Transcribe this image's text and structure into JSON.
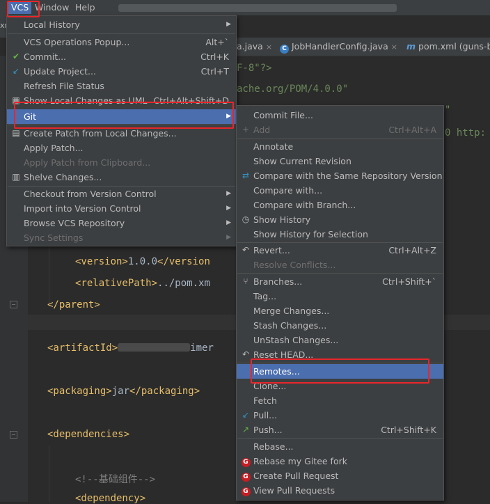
{
  "menubar": {
    "vcs": "VCS",
    "window": "Window",
    "help": "Help",
    "left_frag": "xn"
  },
  "tabs": [
    {
      "label": "a.java"
    },
    {
      "icon": "C",
      "label": "JobHandlerConfig.java"
    },
    {
      "icon": "m",
      "label": "pom.xml (guns-ba"
    }
  ],
  "editor": {
    "frag1": "F-8\"?>",
    "frag2": "ache.org/POM/4.0.0\"",
    "frag3": "\"",
    "frag4": "0 http:",
    "version_open": "<version>",
    "version_val": "1.0.0",
    "version_close": "</version",
    "relpath_open": "<relativePath>",
    "relpath_val": "../pom.xm",
    "parent_close": "</parent>",
    "artifact_open": "<artifactId>",
    "artifact_tail": "imer",
    "packaging_open": "<packaging>",
    "packaging_val": "jar",
    "packaging_close": "</packaging>",
    "deps_open": "<dependencies>",
    "comment": "<!--基础组件-->",
    "dep_open": "<dependency>"
  },
  "vcs_menu": {
    "items": [
      {
        "label": "Local History",
        "submenu": true
      },
      {
        "label": "VCS Operations Popup...",
        "shortcut": "Alt+`"
      },
      {
        "label": "Commit...",
        "shortcut": "Ctrl+K",
        "icon": "✔"
      },
      {
        "label": "Update Project...",
        "shortcut": "Ctrl+T",
        "icon": "↙"
      },
      {
        "label": "Refresh File Status"
      },
      {
        "label": "Show Local Changes as UML",
        "shortcut": "Ctrl+Alt+Shift+D",
        "icon": "▦"
      },
      {
        "label": "Git",
        "submenu": true,
        "selected": true
      },
      {
        "label": "Create Patch from Local Changes...",
        "icon": "▤"
      },
      {
        "label": "Apply Patch..."
      },
      {
        "label": "Apply Patch from Clipboard...",
        "disabled": true
      },
      {
        "label": "Shelve Changes...",
        "icon": "▥"
      },
      {
        "label": "Checkout from Version Control",
        "submenu": true
      },
      {
        "label": "Import into Version Control",
        "submenu": true
      },
      {
        "label": "Browse VCS Repository",
        "submenu": true
      },
      {
        "label": "Sync Settings",
        "submenu": true,
        "disabled": true
      }
    ]
  },
  "git_menu": {
    "items": [
      {
        "label": "Commit File..."
      },
      {
        "label": "Add",
        "shortcut": "Ctrl+Alt+A",
        "disabled": true,
        "icon": "+"
      },
      {
        "label": "Annotate"
      },
      {
        "label": "Show Current Revision"
      },
      {
        "label": "Compare with the Same Repository Version",
        "icon": "⇄"
      },
      {
        "label": "Compare with..."
      },
      {
        "label": "Compare with Branch..."
      },
      {
        "label": "Show History",
        "icon": "◷"
      },
      {
        "label": "Show History for Selection"
      },
      {
        "label": "Revert...",
        "shortcut": "Ctrl+Alt+Z",
        "icon": "↶"
      },
      {
        "label": "Resolve Conflicts...",
        "disabled": true
      },
      {
        "label": "Branches...",
        "shortcut": "Ctrl+Shift+`",
        "icon": "⑂"
      },
      {
        "label": "Tag..."
      },
      {
        "label": "Merge Changes..."
      },
      {
        "label": "Stash Changes..."
      },
      {
        "label": "UnStash Changes..."
      },
      {
        "label": "Reset HEAD...",
        "icon": "↶"
      },
      {
        "label": "Remotes...",
        "selected": true
      },
      {
        "label": "Clone..."
      },
      {
        "label": "Fetch"
      },
      {
        "label": "Pull...",
        "icon": "↙"
      },
      {
        "label": "Push...",
        "shortcut": "Ctrl+Shift+K",
        "icon": "↗"
      },
      {
        "label": "Rebase..."
      },
      {
        "label": "Rebase my Gitee fork",
        "icon": "G"
      },
      {
        "label": "Create Pull Request",
        "icon": "G"
      },
      {
        "label": "View Pull Requests",
        "icon": "G"
      }
    ]
  },
  "colors": {
    "selection": "#4b6eaf",
    "highlight_box": "#e8262b",
    "commit_check": "#62b543",
    "update_arrow": "#3592c4",
    "push_arrow": "#62b543",
    "gitee_red": "#c71d23"
  }
}
